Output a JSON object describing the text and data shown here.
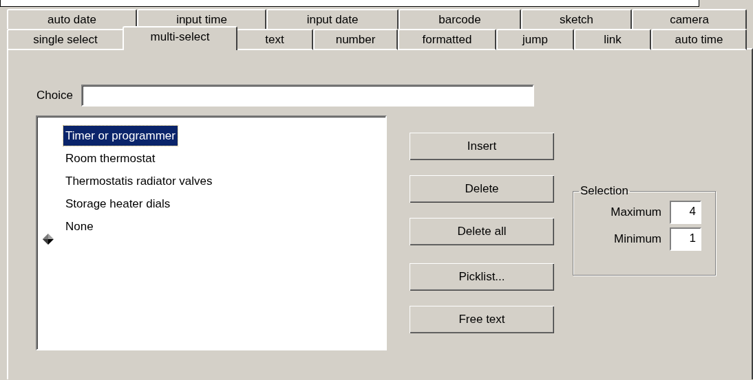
{
  "tab_rows": [
    {
      "tabs": [
        {
          "label": "auto date",
          "selected": false
        },
        {
          "label": "input time",
          "selected": false
        },
        {
          "label": "input date",
          "selected": false
        },
        {
          "label": "barcode",
          "selected": false
        },
        {
          "label": "sketch",
          "selected": false
        },
        {
          "label": "camera",
          "selected": false
        }
      ]
    },
    {
      "tabs": [
        {
          "label": "single select",
          "selected": false
        },
        {
          "label": "multi-select",
          "selected": true
        },
        {
          "label": "text",
          "selected": false
        },
        {
          "label": "number",
          "selected": false
        },
        {
          "label": "formatted",
          "selected": false
        },
        {
          "label": "jump",
          "selected": false
        },
        {
          "label": "link",
          "selected": false
        },
        {
          "label": "auto time",
          "selected": false
        }
      ]
    }
  ],
  "choice": {
    "label": "Choice"
  },
  "list": {
    "items": [
      {
        "label": "Timer or programmer",
        "selected": true
      },
      {
        "label": "Room thermostat",
        "selected": false
      },
      {
        "label": "Thermostatis radiator valves",
        "selected": false
      },
      {
        "label": "Storage heater dials",
        "selected": false
      },
      {
        "label": "None",
        "selected": false
      }
    ]
  },
  "buttons": [
    {
      "label": "Insert"
    },
    {
      "label": "Delete"
    },
    {
      "label": "Delete all"
    },
    {
      "label": "Picklist..."
    },
    {
      "label": "Free text"
    }
  ],
  "selection": {
    "title": "Selection",
    "fields": [
      {
        "label": "Maximum",
        "value": "4"
      },
      {
        "label": "Minimum",
        "value": "1"
      }
    ]
  }
}
